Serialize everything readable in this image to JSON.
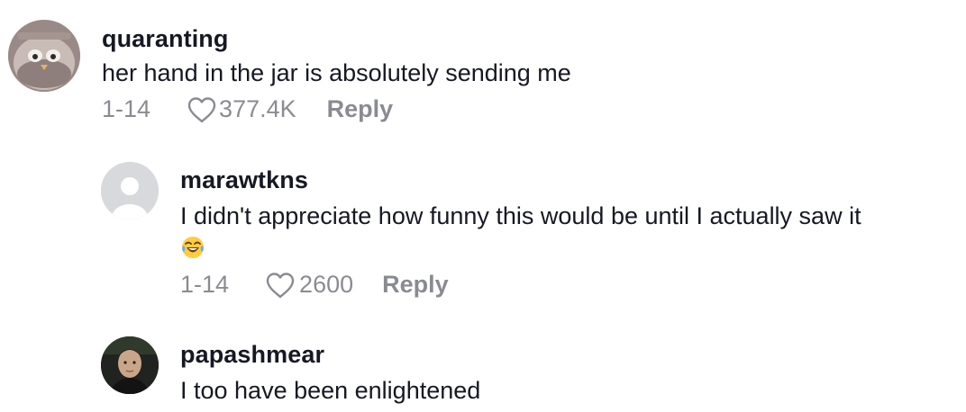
{
  "comments": [
    {
      "username": "quaranting",
      "text": "her hand in the jar is absolutely sending me",
      "date": "1-14",
      "likes": "377.4K",
      "reply_label": "Reply",
      "avatar": "furby-avatar"
    },
    {
      "username": "marawtkns",
      "text": "I didn't appreciate how funny this would be until I actually saw it",
      "emoji": "😂",
      "date": "1-14",
      "likes": "2600",
      "reply_label": "Reply",
      "avatar": "default-avatar"
    },
    {
      "username": "papashmear",
      "text": "I too have been enlightened",
      "avatar": "photo-avatar"
    }
  ],
  "colors": {
    "text": "#161823",
    "muted": "#8a8b91",
    "avatar_default_bg": "#d8d9dc"
  }
}
